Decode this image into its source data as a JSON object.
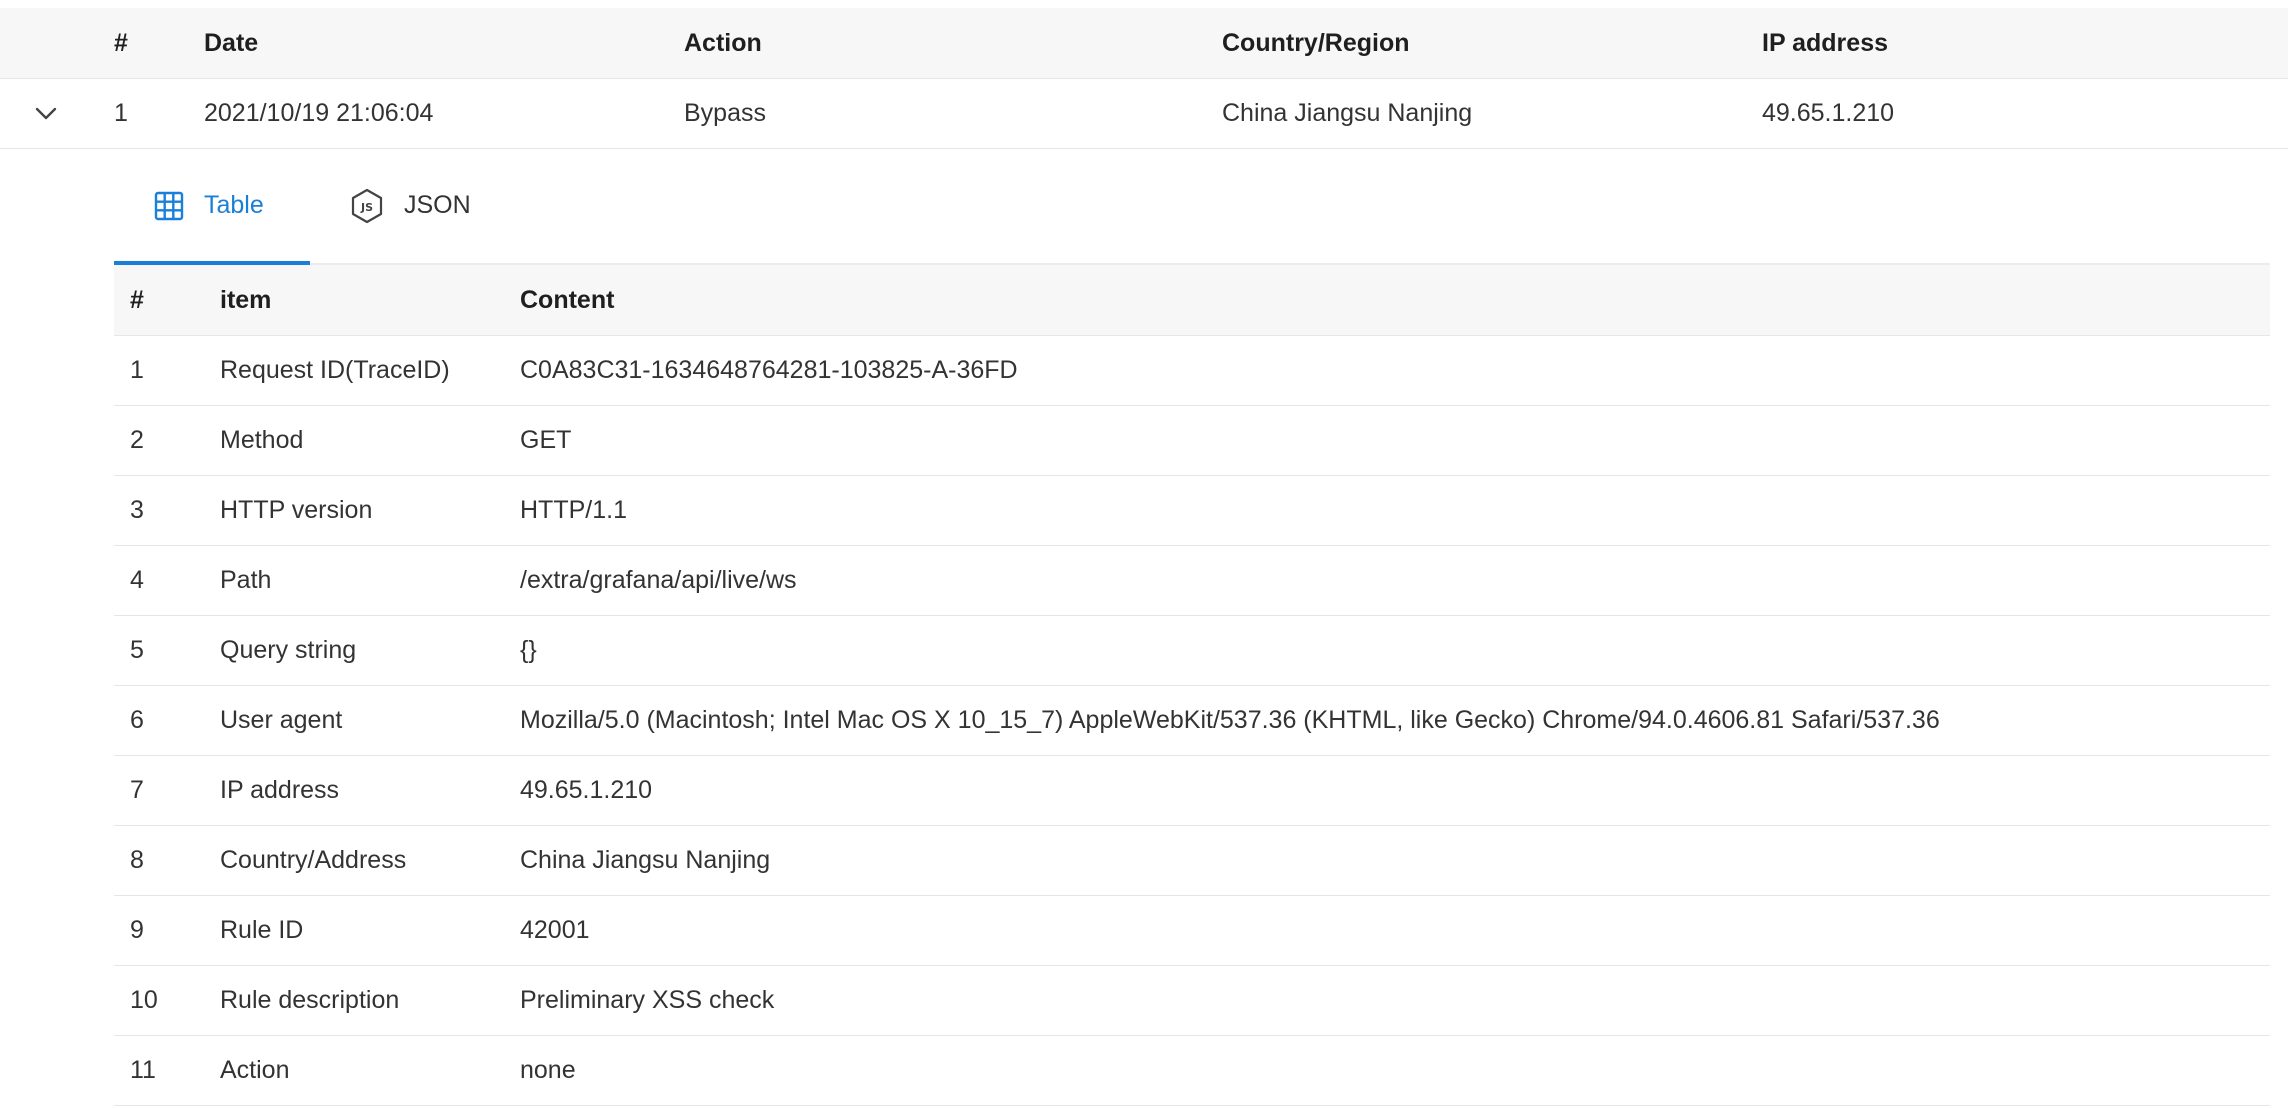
{
  "outer_table": {
    "columns": {
      "num": "#",
      "date": "Date",
      "action": "Action",
      "country": "Country/Region",
      "ip": "IP address"
    },
    "rows": [
      {
        "num": "1",
        "date": "2021/10/19 21:06:04",
        "action": "Bypass",
        "country": "China Jiangsu Nanjing",
        "ip": "49.65.1.210"
      }
    ]
  },
  "tabs": [
    {
      "label": "Table",
      "icon": "grid-icon",
      "active": true
    },
    {
      "label": "JSON",
      "icon": "nodejs-icon",
      "active": false
    }
  ],
  "detail_table": {
    "columns": {
      "num": "#",
      "item": "item",
      "content": "Content"
    },
    "rows": [
      {
        "num": "1",
        "item": "Request ID(TraceID)",
        "content": "C0A83C31-1634648764281-103825-A-36FD"
      },
      {
        "num": "2",
        "item": "Method",
        "content": "GET"
      },
      {
        "num": "3",
        "item": "HTTP version",
        "content": "HTTP/1.1"
      },
      {
        "num": "4",
        "item": "Path",
        "content": "/extra/grafana/api/live/ws"
      },
      {
        "num": "5",
        "item": "Query string",
        "content": "{}"
      },
      {
        "num": "6",
        "item": "User agent",
        "content": "Mozilla/5.0 (Macintosh; Intel Mac OS X 10_15_7) AppleWebKit/537.36 (KHTML, like Gecko) Chrome/94.0.4606.81 Safari/537.36"
      },
      {
        "num": "7",
        "item": "IP address",
        "content": "49.65.1.210"
      },
      {
        "num": "8",
        "item": "Country/Address",
        "content": "China Jiangsu Nanjing"
      },
      {
        "num": "9",
        "item": "Rule ID",
        "content": "42001"
      },
      {
        "num": "10",
        "item": "Rule description",
        "content": "Preliminary XSS check"
      },
      {
        "num": "11",
        "item": "Action",
        "content": "none"
      }
    ]
  },
  "colors": {
    "accent": "#1a7fd8",
    "header_bg": "#f7f7f8",
    "border": "#e6e6e6"
  }
}
